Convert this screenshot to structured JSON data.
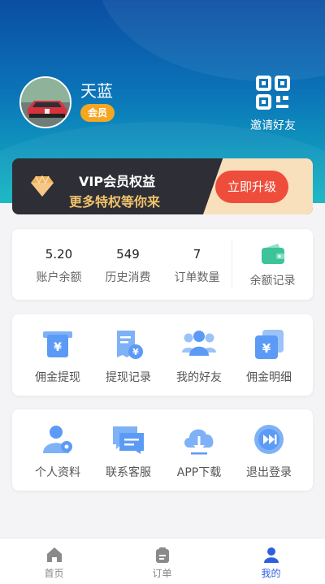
{
  "profile": {
    "username": "天蓝",
    "badge": "会员",
    "avatar_icon": "car-avatar"
  },
  "invite": {
    "label": "邀请好友",
    "icon": "qrcode-icon"
  },
  "vip": {
    "title": "VIP会员权益",
    "subtitle": "更多特权等你来",
    "button": "立即升级",
    "icon": "diamond-icon"
  },
  "stats": [
    {
      "value": "5.20",
      "label": "账户余额"
    },
    {
      "value": "549",
      "label": "历史消费"
    },
    {
      "value": "7",
      "label": "订单数量"
    }
  ],
  "wallet": {
    "label": "余额记录",
    "icon": "wallet-icon"
  },
  "menu1": [
    {
      "label": "佣金提现",
      "icon": "withdraw-icon"
    },
    {
      "label": "提现记录",
      "icon": "withdraw-record-icon"
    },
    {
      "label": "我的好友",
      "icon": "friends-icon"
    },
    {
      "label": "佣金明细",
      "icon": "commission-detail-icon"
    }
  ],
  "menu2": [
    {
      "label": "个人资料",
      "icon": "profile-icon"
    },
    {
      "label": "联系客服",
      "icon": "service-icon"
    },
    {
      "label": "APP下载",
      "icon": "download-icon"
    },
    {
      "label": "退出登录",
      "icon": "logout-icon"
    }
  ],
  "tabs": [
    {
      "label": "首页",
      "icon": "home-icon"
    },
    {
      "label": "订单",
      "icon": "order-icon"
    },
    {
      "label": "我的",
      "icon": "user-icon"
    }
  ],
  "colors": {
    "accent": "#2f5fe0",
    "vip_button": "#ef4d3c",
    "badge": "#f5a623",
    "icon_blue": "#5b9bf5"
  }
}
